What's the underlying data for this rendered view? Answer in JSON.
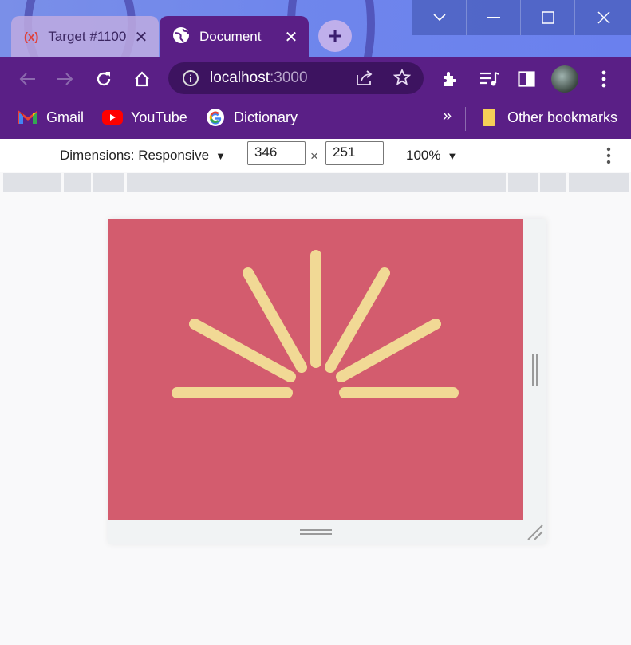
{
  "browser": {
    "tabs": [
      {
        "label": "Target #1100",
        "icon": "target-icon",
        "active": false
      },
      {
        "label": "Document",
        "icon": "globe-icon",
        "active": true
      }
    ],
    "new_tab_label": "+",
    "window_controls": [
      "chevron-down-icon",
      "minimize-icon",
      "maximize-icon",
      "close-icon"
    ]
  },
  "toolbar": {
    "url_host": "localhost",
    "url_port": ":3000"
  },
  "bookmarks": {
    "items": [
      {
        "label": "Gmail",
        "icon": "gmail-icon"
      },
      {
        "label": "YouTube",
        "icon": "youtube-icon"
      },
      {
        "label": "Dictionary",
        "icon": "google-icon"
      }
    ],
    "overflow_label": "»",
    "other_label": "Other bookmarks"
  },
  "devtools": {
    "dimensions_label": "Dimensions: Responsive",
    "width": "346",
    "times": "×",
    "height": "251",
    "zoom": "100%"
  },
  "page": {
    "background_color": "#d35c6e",
    "sun_ray_color": "#f1d995"
  }
}
